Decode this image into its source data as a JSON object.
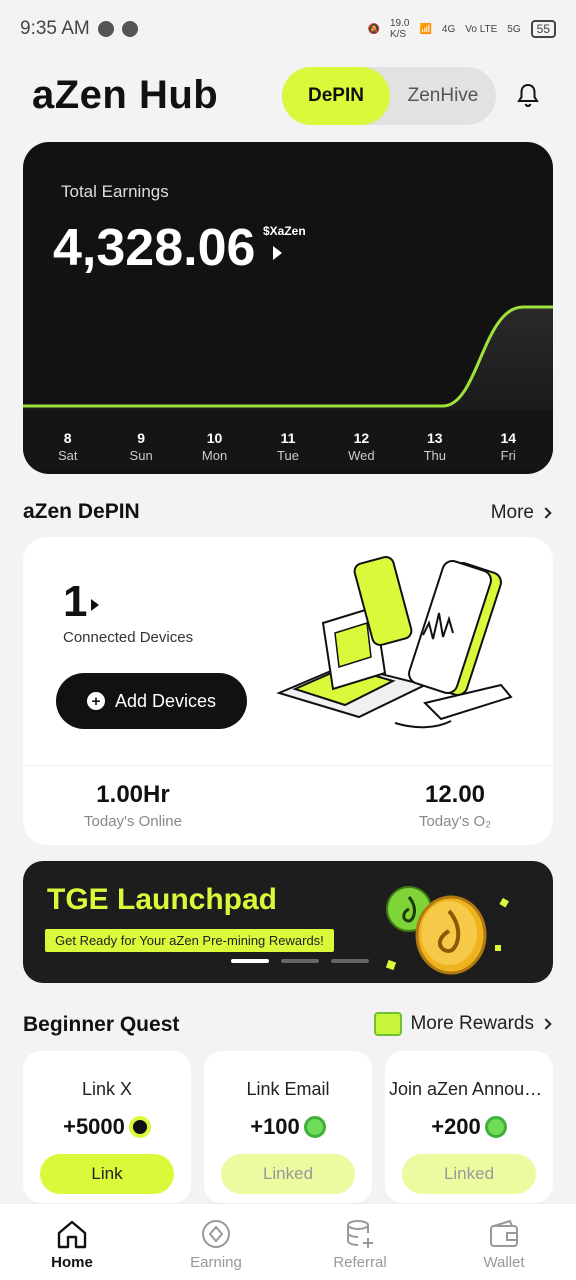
{
  "status_bar": {
    "time": "9:35 AM",
    "net_speed": "19.0",
    "net_unit": "K/S",
    "signal_1": "4G",
    "signal_2": "Vo LTE",
    "signal_3": "5G",
    "battery": "55"
  },
  "header": {
    "brand": "aZen Hub",
    "toggle": {
      "active": "DePIN",
      "inactive": "ZenHive"
    }
  },
  "earnings": {
    "label": "Total Earnings",
    "amount": "4,328.06",
    "unit": "$XaZen",
    "days": [
      {
        "num": "8",
        "wd": "Sat"
      },
      {
        "num": "9",
        "wd": "Sun"
      },
      {
        "num": "10",
        "wd": "Mon"
      },
      {
        "num": "11",
        "wd": "Tue"
      },
      {
        "num": "12",
        "wd": "Wed"
      },
      {
        "num": "13",
        "wd": "Thu"
      },
      {
        "num": "14",
        "wd": "Fri"
      }
    ],
    "accent": "#d9fa3a"
  },
  "depin": {
    "title": "aZen DePIN",
    "more": "More",
    "count": "1",
    "count_label": "Connected Devices",
    "add_button": "Add Devices",
    "stats": [
      {
        "value": "1.00Hr",
        "label": "Today's Online"
      },
      {
        "value": "12.00",
        "label": "Today's O₂"
      }
    ]
  },
  "banner": {
    "title": "TGE Launchpad",
    "subtitle": "Get Ready for Your aZen Pre-mining Rewards!"
  },
  "quests": {
    "title": "Beginner Quest",
    "more": "More Rewards",
    "items": [
      {
        "title": "Link X",
        "reward": "+5000",
        "button": "Link"
      },
      {
        "title": "Link Email",
        "reward": "+100",
        "button": "Linked"
      },
      {
        "title": "Join aZen Announ...",
        "reward": "+200",
        "button": "Linked"
      }
    ]
  },
  "tabbar": {
    "items": [
      "Home",
      "Earning",
      "Referral",
      "Wallet"
    ]
  }
}
